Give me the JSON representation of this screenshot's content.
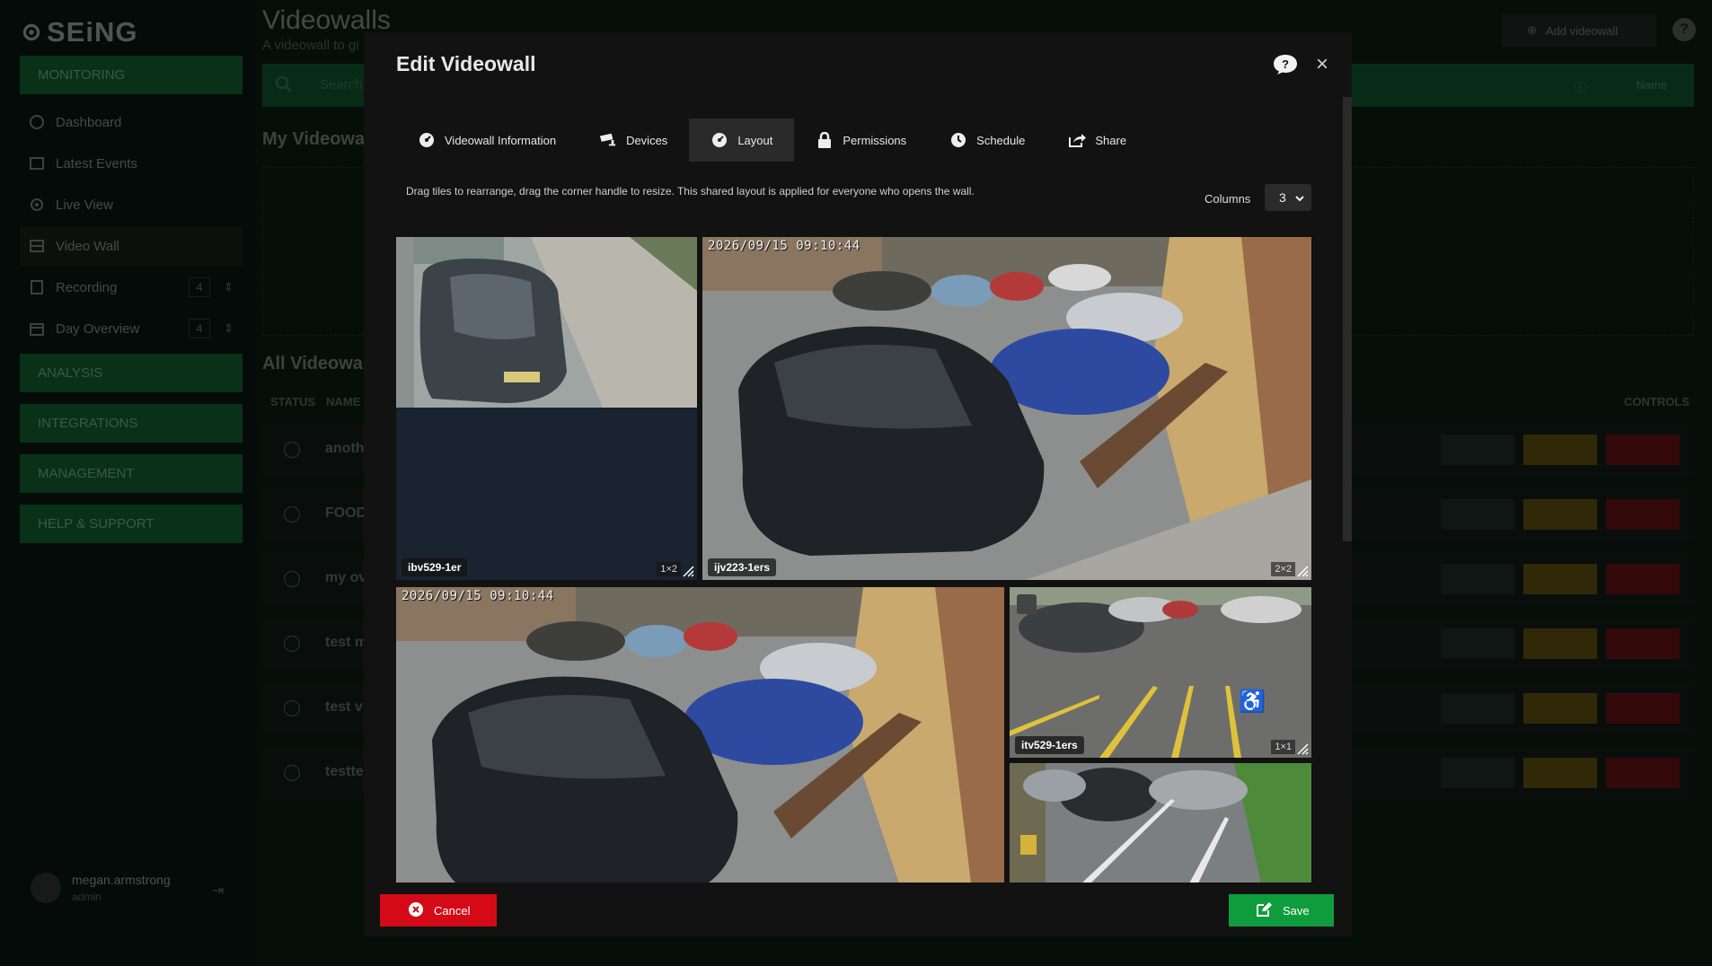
{
  "app": {
    "logo_text": "SEiNG"
  },
  "sidebar": {
    "sections": [
      "MONITORING",
      "ANALYSIS",
      "INTEGRATIONS",
      "MANAGEMENT",
      "HELP & SUPPORT"
    ],
    "items": [
      {
        "label": "Dashboard",
        "icon": "dashboard-icon"
      },
      {
        "label": "Latest Events",
        "icon": "image-icon"
      },
      {
        "label": "Live View",
        "icon": "broadcast-icon"
      },
      {
        "label": "Video Wall",
        "icon": "videowall-icon"
      },
      {
        "label": "Recording",
        "icon": "film-icon",
        "count": "4"
      },
      {
        "label": "Day Overview",
        "icon": "calendar-icon",
        "count": "4"
      }
    ],
    "user": {
      "name": "megan.armstrong",
      "role": "admin"
    }
  },
  "page": {
    "title": "Videowalls",
    "subtitle": "A videowall to gi",
    "add_button": "Add videowall",
    "search_placeholder": "Search",
    "sort_label": "Name",
    "my_section": "My Videowa",
    "all_section": "All Videowal",
    "columns": {
      "status": "STATUS",
      "name": "NAME",
      "controls": "CONTROLS"
    },
    "rows": [
      "anoth",
      "FOOD",
      "my ov",
      "test m",
      "test v",
      "testte"
    ]
  },
  "modal": {
    "title": "Edit Videowall",
    "tabs": [
      {
        "label": "Videowall Information",
        "icon": "dashboard-icon"
      },
      {
        "label": "Devices",
        "icon": "cctv-camera-icon"
      },
      {
        "label": "Layout",
        "icon": "gauge-icon",
        "active": true
      },
      {
        "label": "Permissions",
        "icon": "lock-icon"
      },
      {
        "label": "Schedule",
        "icon": "clock-icon"
      },
      {
        "label": "Share",
        "icon": "share-icon"
      }
    ],
    "hint": "Drag tiles to rearrange, drag the corner handle to resize. This shared layout is applied for everyone who opens the wall.",
    "columns_label": "Columns",
    "columns_value": "3",
    "tiles": [
      {
        "label": "ibv529-1er",
        "size": "1×2"
      },
      {
        "label": "ijv223-1ers",
        "size": "2×2",
        "timestamp": "2026/09/15 09:10:44"
      },
      {
        "label": "",
        "size": "",
        "timestamp": "2026/09/15 09:10:44"
      },
      {
        "label": "itv529-1ers",
        "size": "1×1"
      },
      {
        "label": "",
        "size": ""
      }
    ],
    "cancel_label": "Cancel",
    "save_label": "Save",
    "colors": {
      "cancel": "#d40b17",
      "save": "#0f9c3c",
      "accent_green": "#0f5a2c"
    }
  }
}
